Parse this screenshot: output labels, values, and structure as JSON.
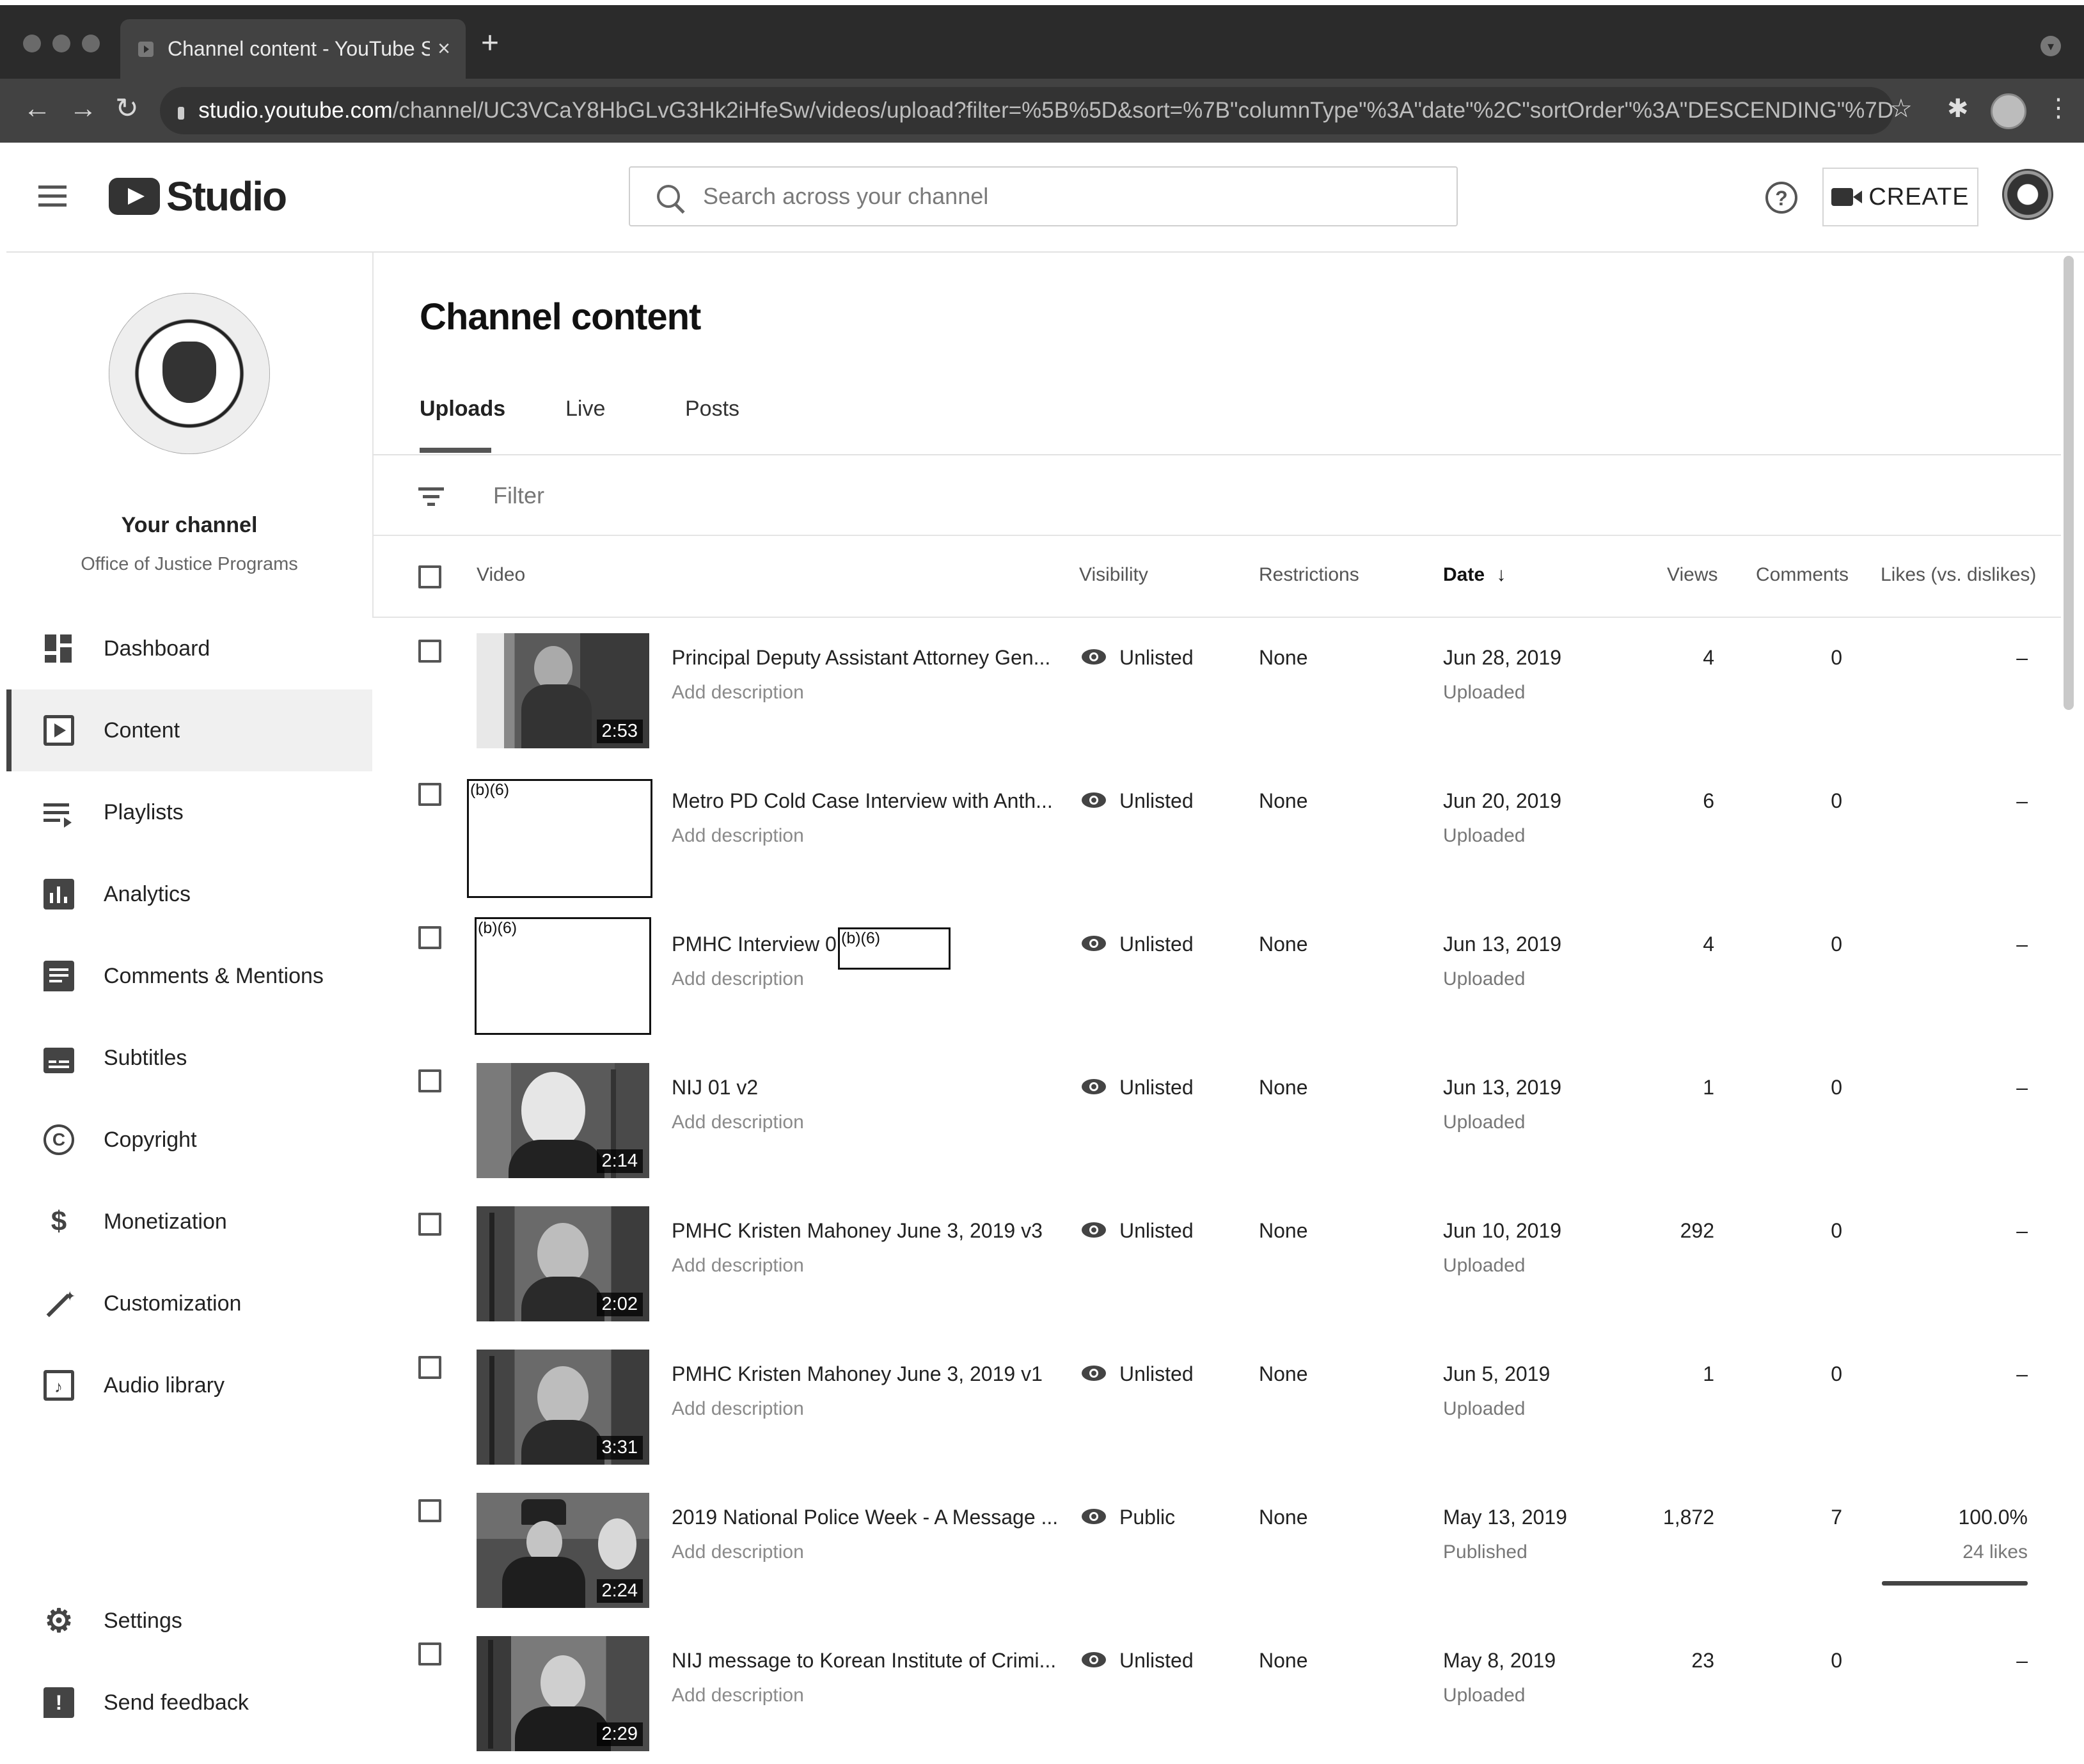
{
  "browser": {
    "tab_title": "Channel content - YouTube Studio",
    "tab_close": "×",
    "new_tab": "+",
    "url_host": "studio.youtube.com",
    "url_path": "/channel/UC3VCaY8HbGLvG3Hk2iHfeSw/videos/upload?filter=%5B%5D&sort=%7B\"columnType\"%3A\"date\"%2C\"sortOrder\"%3A\"DESCENDING\"%7D",
    "back": "←",
    "forward": "→",
    "reload": "↻",
    "star": "☆",
    "extensions": "✱",
    "menu": "⋮"
  },
  "header": {
    "logo_text": "Studio",
    "search_placeholder": "Search across your channel",
    "help": "?",
    "create_label": "CREATE"
  },
  "sidebar": {
    "channel_name": "Your channel",
    "channel_sub": "Office of Justice Programs",
    "items": [
      {
        "label": "Dashboard",
        "icon": "dashboard-icon"
      },
      {
        "label": "Content",
        "icon": "content-icon",
        "active": true
      },
      {
        "label": "Playlists",
        "icon": "playlists-icon"
      },
      {
        "label": "Analytics",
        "icon": "analytics-icon"
      },
      {
        "label": "Comments & Mentions",
        "icon": "comments-icon"
      },
      {
        "label": "Subtitles",
        "icon": "subtitles-icon"
      },
      {
        "label": "Copyright",
        "icon": "copyright-icon"
      },
      {
        "label": "Monetization",
        "icon": "dollar-icon"
      },
      {
        "label": "Customization",
        "icon": "magic-wand-icon"
      },
      {
        "label": "Audio library",
        "icon": "audio-library-icon"
      }
    ],
    "bottom_items": [
      {
        "label": "Settings",
        "icon": "gear-icon"
      },
      {
        "label": "Send feedback",
        "icon": "feedback-icon"
      }
    ]
  },
  "main": {
    "title": "Channel content",
    "tabs": [
      "Uploads",
      "Live",
      "Posts"
    ],
    "filter_placeholder": "Filter",
    "columns": {
      "video": "Video",
      "visibility": "Visibility",
      "restrictions": "Restrictions",
      "date": "Date",
      "date_sort": "↓",
      "views": "Views",
      "comments": "Comments",
      "likes": "Likes (vs. dislikes)"
    },
    "rows": [
      {
        "title": "Principal Deputy Assistant Attorney Gen...",
        "desc": "Add description",
        "duration": "2:53",
        "visibility": "Unlisted",
        "restrictions": "None",
        "date": "Jun 28, 2019",
        "status": "Uploaded",
        "views": "4",
        "comments": "0",
        "likes": "–",
        "redacted_thumb": false
      },
      {
        "title": "Metro PD Cold Case Interview with Anth...",
        "desc": "Add description",
        "duration": "",
        "visibility": "Unlisted",
        "restrictions": "None",
        "date": "Jun 20, 2019",
        "status": "Uploaded",
        "views": "6",
        "comments": "0",
        "likes": "–",
        "redacted_thumb": true,
        "redaction_label": "(b)(6)"
      },
      {
        "title": "PMHC Interview 01",
        "desc": "Add description",
        "duration": "",
        "visibility": "Unlisted",
        "restrictions": "None",
        "date": "Jun 13, 2019",
        "status": "Uploaded",
        "views": "4",
        "comments": "0",
        "likes": "–",
        "redacted_thumb": true,
        "redaction_label": "(b)(6)",
        "title_redaction": "(b)(6)"
      },
      {
        "title": "NIJ 01 v2",
        "desc": "Add description",
        "duration": "2:14",
        "visibility": "Unlisted",
        "restrictions": "None",
        "date": "Jun 13, 2019",
        "status": "Uploaded",
        "views": "1",
        "comments": "0",
        "likes": "–",
        "redacted_thumb": false
      },
      {
        "title": "PMHC Kristen Mahoney June 3, 2019 v3",
        "desc": "Add description",
        "duration": "2:02",
        "visibility": "Unlisted",
        "restrictions": "None",
        "date": "Jun 10, 2019",
        "status": "Uploaded",
        "views": "292",
        "comments": "0",
        "likes": "–",
        "redacted_thumb": false
      },
      {
        "title": "PMHC Kristen Mahoney June 3, 2019 v1",
        "desc": "Add description",
        "duration": "3:31",
        "visibility": "Unlisted",
        "restrictions": "None",
        "date": "Jun 5, 2019",
        "status": "Uploaded",
        "views": "1",
        "comments": "0",
        "likes": "–",
        "redacted_thumb": false
      },
      {
        "title": "2019 National Police Week - A Message ...",
        "desc": "Add description",
        "duration": "2:24",
        "visibility": "Public",
        "restrictions": "None",
        "date": "May 13, 2019",
        "status": "Published",
        "views": "1,872",
        "comments": "7",
        "likes": "100.0%",
        "likes_sub": "24 likes",
        "likes_ratio": 1.0,
        "redacted_thumb": false
      },
      {
        "title": "NIJ message to Korean Institute of Crimi...",
        "desc": "Add description",
        "duration": "2:29",
        "visibility": "Unlisted",
        "restrictions": "None",
        "date": "May 8, 2019",
        "status": "Uploaded",
        "views": "23",
        "comments": "0",
        "likes": "–",
        "redacted_thumb": false
      }
    ]
  }
}
